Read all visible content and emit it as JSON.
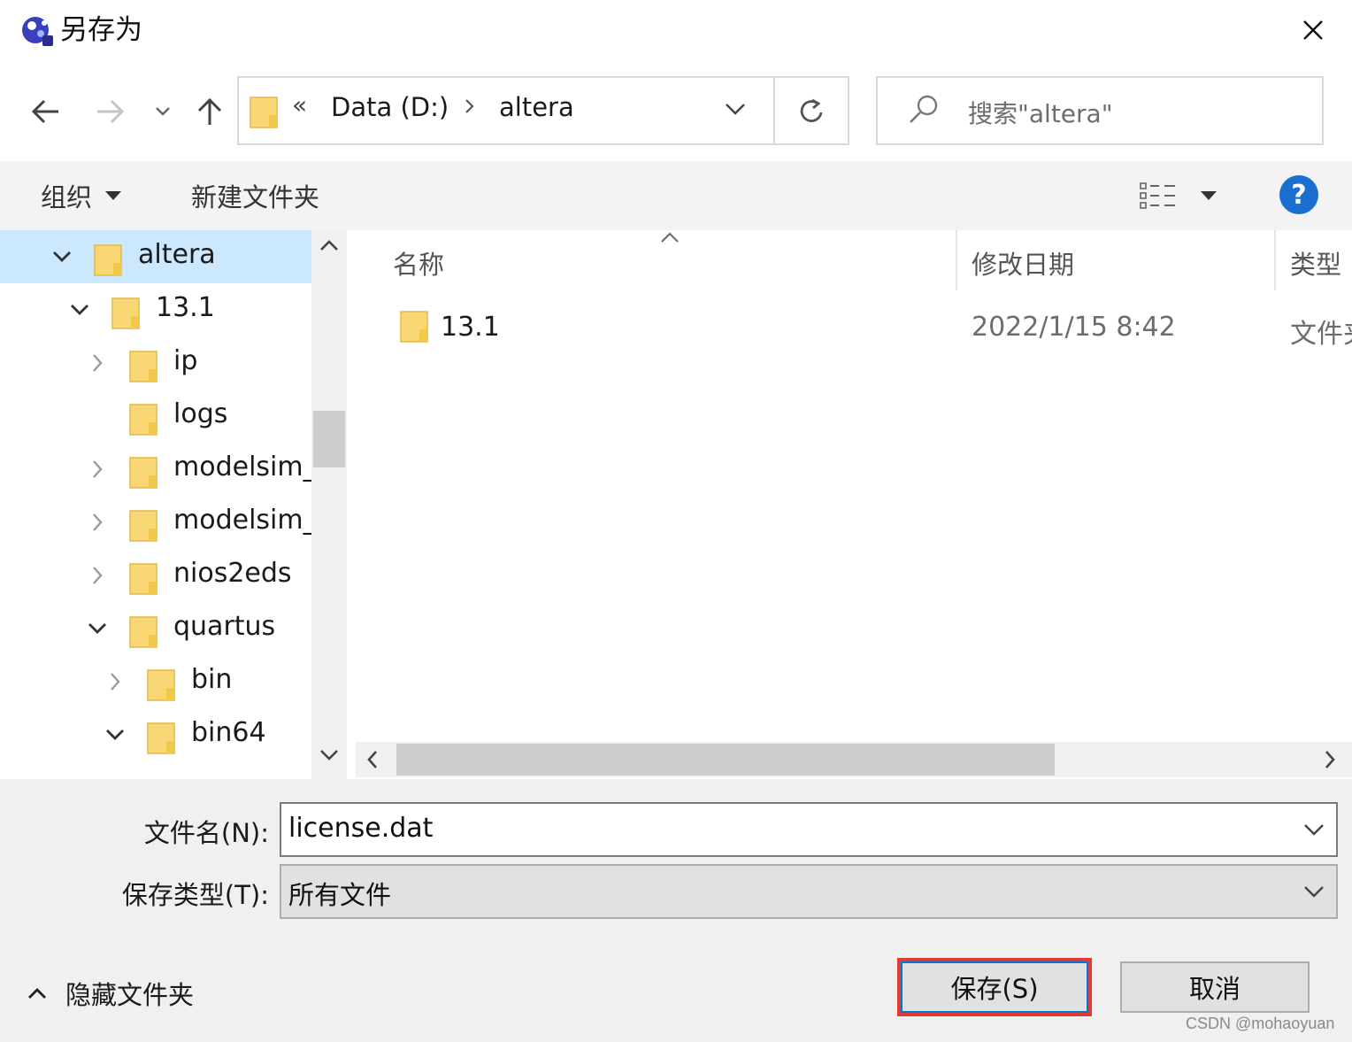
{
  "window": {
    "title": "另存为"
  },
  "nav": {
    "address": {
      "overflow_chevron": "«",
      "segments": [
        "Data (D:)",
        "altera"
      ]
    },
    "search_placeholder": "搜索\"altera\""
  },
  "toolbar": {
    "organize": "组织",
    "new_folder": "新建文件夹",
    "help": "?"
  },
  "tree": [
    {
      "label": "altera",
      "expanded": true,
      "selected": true
    },
    {
      "label": "13.1",
      "expanded": true
    },
    {
      "label": "ip",
      "expanded": false
    },
    {
      "label": "logs"
    },
    {
      "label": "modelsim_",
      "expanded": false
    },
    {
      "label": "modelsim_",
      "expanded": false
    },
    {
      "label": "nios2eds",
      "expanded": false
    },
    {
      "label": "quartus",
      "expanded": true
    },
    {
      "label": "bin",
      "expanded": false
    },
    {
      "label": "bin64",
      "expanded": true
    }
  ],
  "filelist": {
    "columns": [
      "名称",
      "修改日期",
      "类型"
    ],
    "rows": [
      {
        "name": "13.1",
        "modified": "2022/1/15 8:42",
        "type": "文件夹"
      }
    ]
  },
  "form": {
    "filename_label": "文件名(N):",
    "filename_value": "license.dat",
    "filetype_label": "保存类型(T):",
    "filetype_value": "所有文件"
  },
  "footer": {
    "hide_folders": "隐藏文件夹",
    "save": "保存(S)",
    "cancel": "取消",
    "watermark": "CSDN @mohaoyuan"
  },
  "colors": {
    "accent": "#0078d7",
    "selection": "#cce8ff",
    "highlight_box": "#e53935",
    "help": "#1a6fd0",
    "folder": "#f8d774"
  }
}
